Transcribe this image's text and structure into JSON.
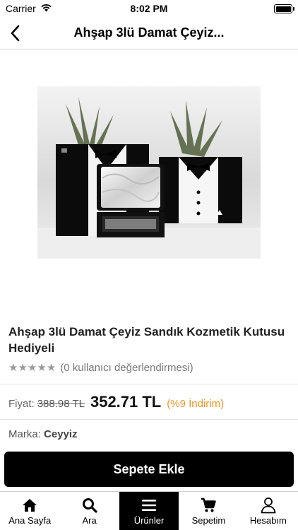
{
  "status": {
    "carrier": "Carrier",
    "time": "8:02 PM"
  },
  "nav": {
    "title": "Ahşap 3lü Damat Çeyiz..."
  },
  "product": {
    "title": "Ahşap 3lü Damat Çeyiz Sandık Kozmetik Kutusu Hediyeli",
    "rating_text": "(0 kullanıcı değerlendirmesi)",
    "rating_value": 0,
    "price_label": "Fiyat:",
    "old_price": "388.98 TL",
    "new_price": "352.71 TL",
    "discount": "(%9  İndirim)",
    "brand_label": "Marka:",
    "brand": "Ceyyiz"
  },
  "actions": {
    "add_to_cart": "Sepete Ekle"
  },
  "tabs": [
    {
      "label": "Ana Sayfa",
      "icon": "home-icon"
    },
    {
      "label": "Ara",
      "icon": "search-icon"
    },
    {
      "label": "Ürünler",
      "icon": "menu-icon",
      "active": true
    },
    {
      "label": "Sepetim",
      "icon": "cart-icon"
    },
    {
      "label": "Hesabım",
      "icon": "user-icon"
    }
  ]
}
